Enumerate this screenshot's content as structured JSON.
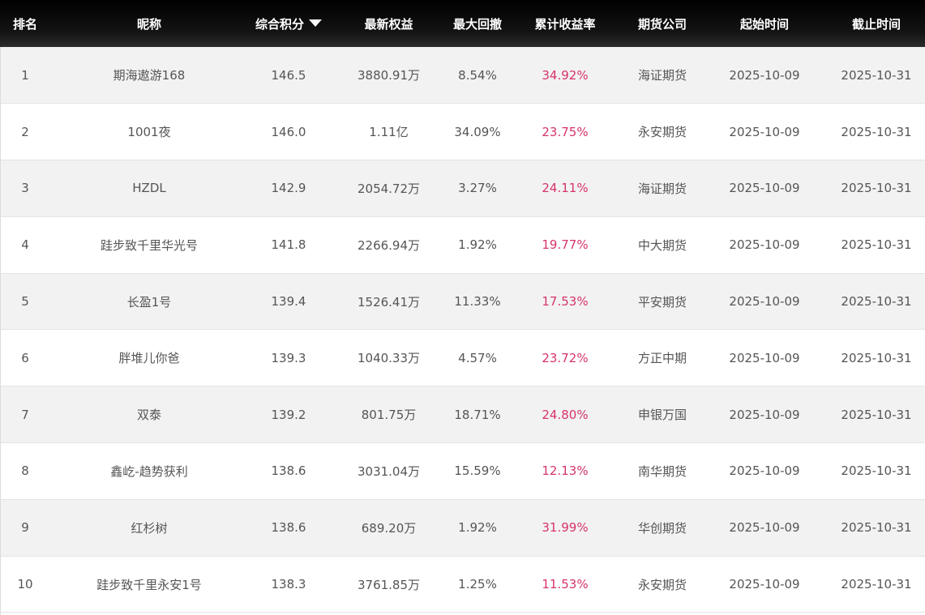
{
  "columns": [
    "排名",
    "昵称",
    "综合积分",
    "最新权益",
    "最大回撤",
    "累计收益率",
    "期货公司",
    "起始时间",
    "截止时间"
  ],
  "sort_column": "综合积分",
  "accent_color": "#d6336c",
  "rows": [
    {
      "rank": "1",
      "name": "期海遨游168",
      "score": "146.5",
      "equity": "3880.91万",
      "drawdown": "8.54%",
      "return": "34.92%",
      "company": "海证期货",
      "start": "2025-10-09",
      "end": "2025-10-31"
    },
    {
      "rank": "2",
      "name": "1001夜",
      "score": "146.0",
      "equity": "1.11亿",
      "drawdown": "34.09%",
      "return": "23.75%",
      "company": "永安期货",
      "start": "2025-10-09",
      "end": "2025-10-31"
    },
    {
      "rank": "3",
      "name": "HZDL",
      "score": "142.9",
      "equity": "2054.72万",
      "drawdown": "3.27%",
      "return": "24.11%",
      "company": "海证期货",
      "start": "2025-10-09",
      "end": "2025-10-31"
    },
    {
      "rank": "4",
      "name": "跬步致千里华光号",
      "score": "141.8",
      "equity": "2266.94万",
      "drawdown": "1.92%",
      "return": "19.77%",
      "company": "中大期货",
      "start": "2025-10-09",
      "end": "2025-10-31"
    },
    {
      "rank": "5",
      "name": "长盈1号",
      "score": "139.4",
      "equity": "1526.41万",
      "drawdown": "11.33%",
      "return": "17.53%",
      "company": "平安期货",
      "start": "2025-10-09",
      "end": "2025-10-31"
    },
    {
      "rank": "6",
      "name": "胖堆儿你爸",
      "score": "139.3",
      "equity": "1040.33万",
      "drawdown": "4.57%",
      "return": "23.72%",
      "company": "方正中期",
      "start": "2025-10-09",
      "end": "2025-10-31"
    },
    {
      "rank": "7",
      "name": "双泰",
      "score": "139.2",
      "equity": "801.75万",
      "drawdown": "18.71%",
      "return": "24.80%",
      "company": "申银万国",
      "start": "2025-10-09",
      "end": "2025-10-31"
    },
    {
      "rank": "8",
      "name": "鑫屹-趋势获利",
      "score": "138.6",
      "equity": "3031.04万",
      "drawdown": "15.59%",
      "return": "12.13%",
      "company": "南华期货",
      "start": "2025-10-09",
      "end": "2025-10-31"
    },
    {
      "rank": "9",
      "name": "红杉树",
      "score": "138.6",
      "equity": "689.20万",
      "drawdown": "1.92%",
      "return": "31.99%",
      "company": "华创期货",
      "start": "2025-10-09",
      "end": "2025-10-31"
    },
    {
      "rank": "10",
      "name": "跬步致千里永安1号",
      "score": "138.3",
      "equity": "3761.85万",
      "drawdown": "1.25%",
      "return": "11.53%",
      "company": "永安期货",
      "start": "2025-10-09",
      "end": "2025-10-31"
    }
  ]
}
